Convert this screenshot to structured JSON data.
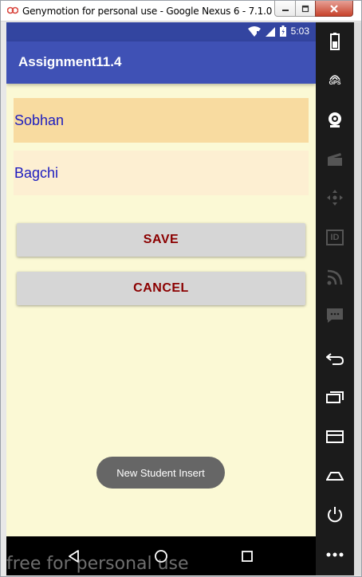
{
  "window": {
    "title": "Genymotion for personal use - Google Nexus 6 - 7.1.0 - ...",
    "watermark": "free for personal use"
  },
  "statusbar": {
    "time": "5:03",
    "icons": [
      "wifi-icon",
      "signal-icon",
      "battery-icon"
    ]
  },
  "app": {
    "title": "Assignment11.4",
    "accent_color": "#3f51b5",
    "statusbar_color": "#3345a0",
    "background_color": "#fbf9d5"
  },
  "form": {
    "first_name": "Sobhan",
    "last_name": "Bagchi"
  },
  "buttons": {
    "save": "SAVE",
    "cancel": "CANCEL"
  },
  "toast": {
    "message": "New Student Insert"
  },
  "navbar": {
    "icons": [
      "back-icon",
      "home-icon",
      "recents-icon"
    ]
  },
  "sidebar": {
    "icons": [
      "battery-icon",
      "gps-icon",
      "camera-icon",
      "video-icon",
      "dpad-icon",
      "id-icon",
      "rss-icon",
      "sms-icon",
      "back-icon",
      "recents-icon",
      "menu-icon",
      "home-icon",
      "power-icon",
      "more-icon"
    ],
    "gps_label": "GPS",
    "id_label": "ID"
  }
}
